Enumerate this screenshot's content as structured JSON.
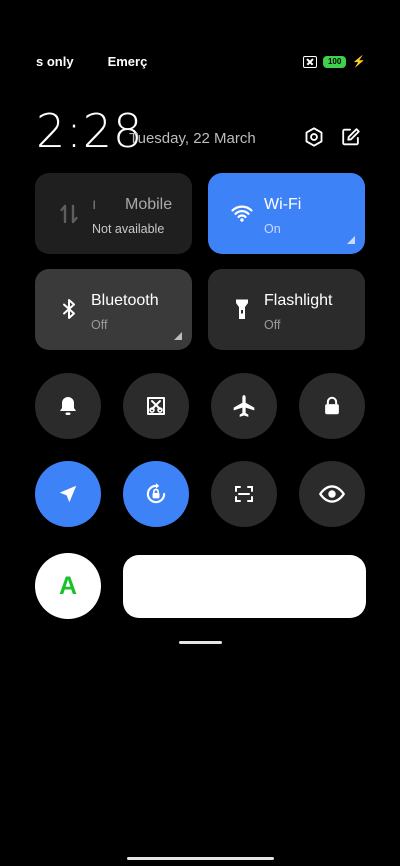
{
  "status_bar": {
    "carrier_text": "s only",
    "emergency_text": "Emerç",
    "battery_level": "100",
    "charging": true,
    "battery_color": "#3fd14a"
  },
  "header": {
    "time": "2:28",
    "date": "Tuesday, 22 March"
  },
  "tiles": {
    "mobile": {
      "title": "Mobile",
      "prefix": "ı",
      "subtitle": "Not available",
      "state": "unavailable"
    },
    "wifi": {
      "title": "Wi-Fi",
      "subtitle": "On",
      "state": "on"
    },
    "bluetooth": {
      "title": "Bluetooth",
      "subtitle": "Off",
      "state": "off"
    },
    "flashlight": {
      "title": "Flashlight",
      "subtitle": "Off",
      "state": "off"
    }
  },
  "toggles_row1": [
    {
      "icon": "bell-icon",
      "state": "off"
    },
    {
      "icon": "screenshot-icon",
      "state": "off"
    },
    {
      "icon": "airplane-icon",
      "state": "off"
    },
    {
      "icon": "lock-icon",
      "state": "off"
    }
  ],
  "toggles_row2": [
    {
      "icon": "location-arrow-icon",
      "state": "on"
    },
    {
      "icon": "rotation-lock-icon",
      "state": "on"
    },
    {
      "icon": "scan-icon",
      "state": "off"
    },
    {
      "icon": "eye-icon",
      "state": "off"
    }
  ],
  "avatar": {
    "letter": "A",
    "color": "#19c12b"
  },
  "colors": {
    "accent": "#3e82f7",
    "tile_inactive": "#2b2b2b",
    "tile_mobile": "#1f1f1f"
  }
}
